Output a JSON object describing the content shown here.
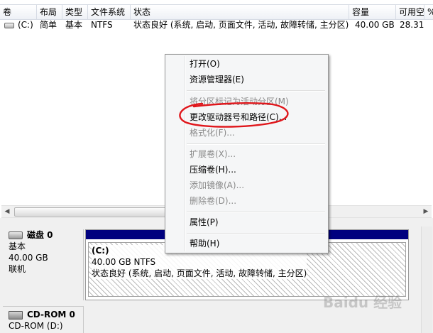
{
  "columns": [
    "卷",
    "布局",
    "类型",
    "文件系统",
    "状态",
    "容量",
    "可用空间",
    "%"
  ],
  "volume_row": {
    "volume": "(C:)",
    "layout": "简单",
    "type": "基本",
    "filesystem": "NTFS",
    "status": "状态良好 (系统, 启动, 页面文件, 活动, 故障转储, 主分区)",
    "capacity": "40.00 GB",
    "free": "28.31"
  },
  "disks": [
    {
      "title": "磁盘 0",
      "kind": "基本",
      "size": "40.00 GB",
      "state": "联机"
    },
    {
      "title": "CD-ROM 0",
      "kind": "CD-ROM (D:)"
    }
  ],
  "partition": {
    "name": "(C:)",
    "size_fs": "40.00 GB NTFS",
    "status": "状态良好 (系统, 启动, 页面文件, 活动, 故障转储, 主分区)"
  },
  "context_menu": {
    "open": "打开(O)",
    "explorer": "资源管理器(E)",
    "mark_active": "将分区标记为活动分区(M)",
    "change_letter": "更改驱动器号和路径(C)...",
    "format": "格式化(F)...",
    "extend": "扩展卷(X)...",
    "shrink": "压缩卷(H)...",
    "add_mirror": "添加镜像(A)...",
    "delete": "删除卷(D)...",
    "properties": "属性(P)",
    "help": "帮助(H)"
  },
  "colors": {
    "partition_bar": "#00007f",
    "annotation": "#e0161b"
  }
}
